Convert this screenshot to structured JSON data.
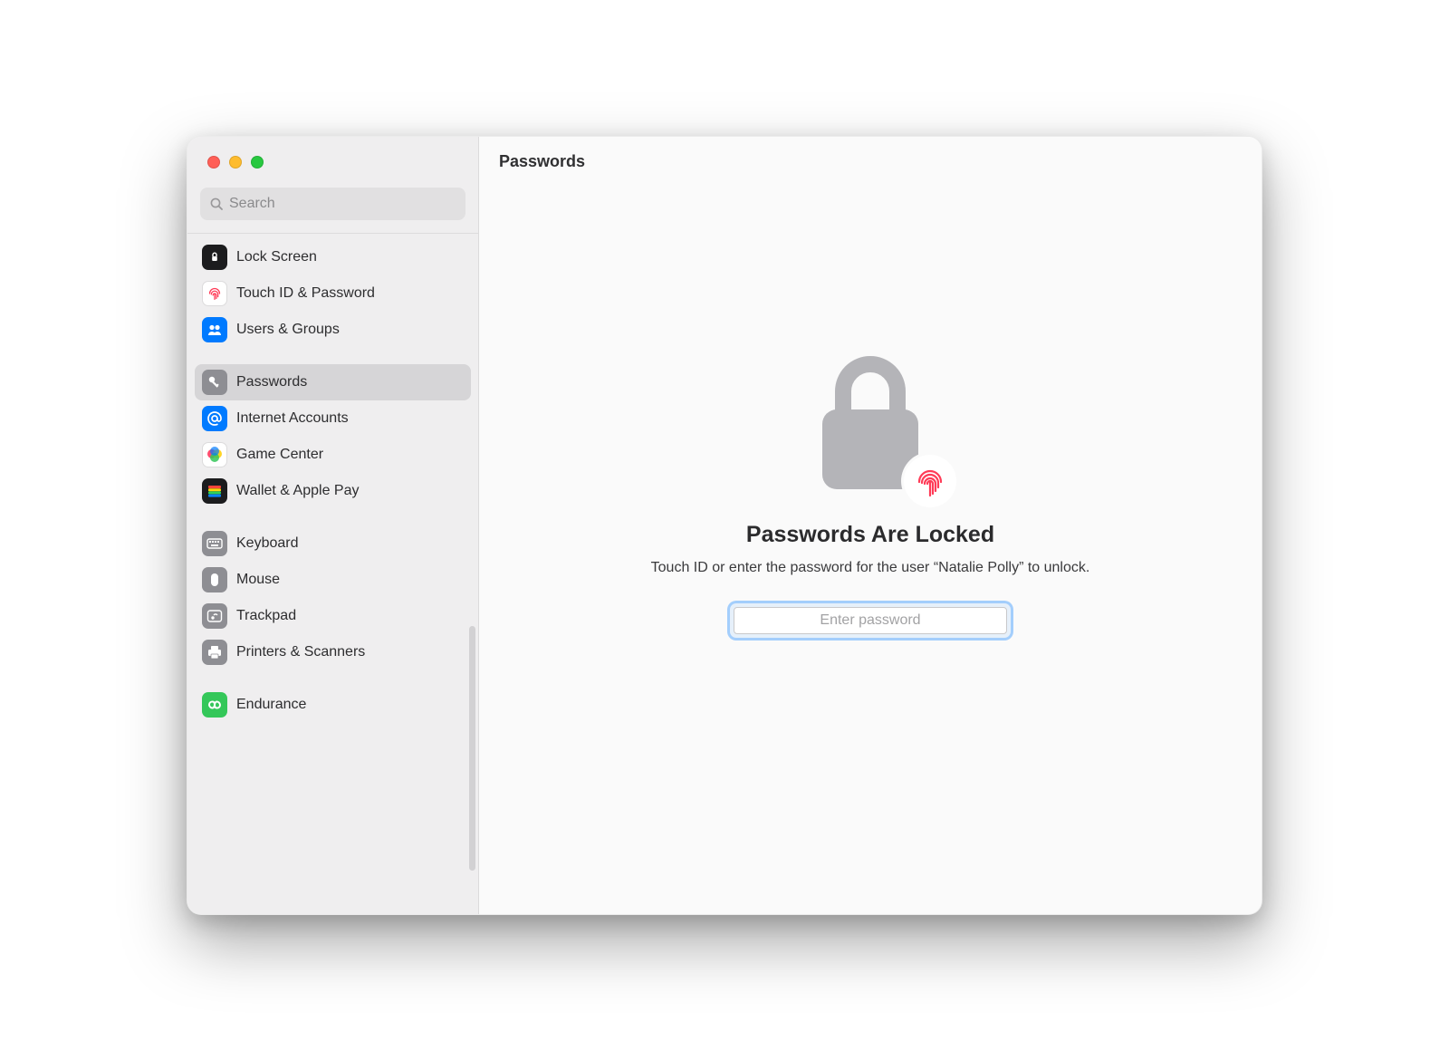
{
  "header": {
    "title": "Passwords"
  },
  "search": {
    "placeholder": "Search"
  },
  "sidebar": {
    "items": [
      {
        "id": "lock-screen",
        "label": "Lock Screen",
        "icon": "lock-screen-icon"
      },
      {
        "id": "touch-id",
        "label": "Touch ID & Password",
        "icon": "fingerprint-icon"
      },
      {
        "id": "users-groups",
        "label": "Users & Groups",
        "icon": "users-icon"
      },
      {
        "id": "passwords",
        "label": "Passwords",
        "icon": "key-icon",
        "selected": true
      },
      {
        "id": "internet-accounts",
        "label": "Internet Accounts",
        "icon": "at-sign-icon"
      },
      {
        "id": "game-center",
        "label": "Game Center",
        "icon": "game-center-icon"
      },
      {
        "id": "wallet",
        "label": "Wallet & Apple Pay",
        "icon": "wallet-icon"
      },
      {
        "id": "keyboard",
        "label": "Keyboard",
        "icon": "keyboard-icon"
      },
      {
        "id": "mouse",
        "label": "Mouse",
        "icon": "mouse-icon"
      },
      {
        "id": "trackpad",
        "label": "Trackpad",
        "icon": "trackpad-icon"
      },
      {
        "id": "printers",
        "label": "Printers & Scanners",
        "icon": "printer-icon"
      },
      {
        "id": "endurance",
        "label": "Endurance",
        "icon": "infinity-icon"
      }
    ]
  },
  "content": {
    "title": "Passwords Are Locked",
    "subtitle": "Touch ID or enter the password for the user “Natalie Polly” to unlock.",
    "placeholder": "Enter password"
  },
  "colors": {
    "accent": "#007aff",
    "touch_id_red": "#ff3b57"
  }
}
